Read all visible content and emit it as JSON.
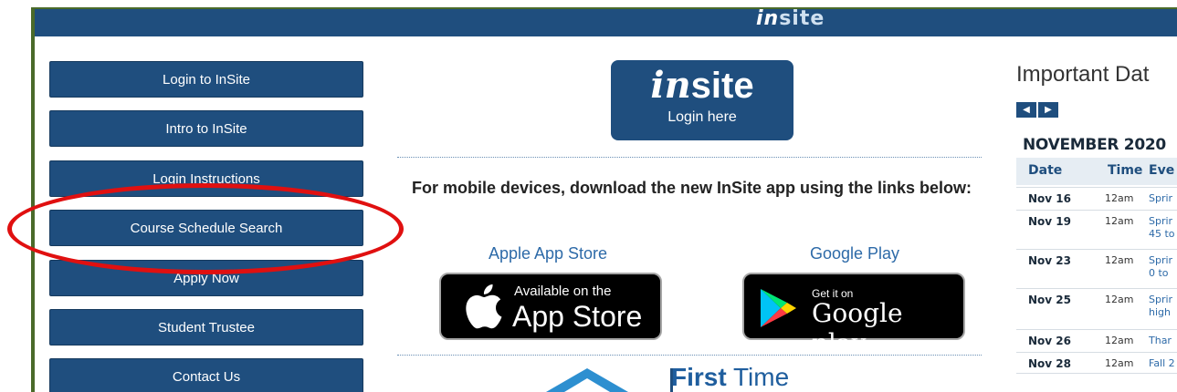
{
  "header": {
    "logo_in": "in",
    "logo_site": "site"
  },
  "nav": [
    "Login to InSite",
    "Intro to InSite",
    "Login Instructions",
    "Course Schedule Search",
    "Apply Now",
    "Student Trustee",
    "Contact Us"
  ],
  "insite": {
    "logo_in": "in",
    "logo_site": "site",
    "sub": "Login here"
  },
  "mobile": {
    "text": "For mobile devices, download the new InSite app using the links below:",
    "apple_title": "Apple App Store",
    "google_title": "Google Play",
    "apple_small": "Available on the",
    "apple_big": "App Store",
    "google_small": "Get it on",
    "google_big": "Google play"
  },
  "first_time": {
    "bold": "First",
    "rest": " Time"
  },
  "important": {
    "title": "Important Dat",
    "prev_icon": "triangle-left-icon",
    "next_icon": "triangle-right-icon",
    "month": "NOVEMBER 2020",
    "headers": [
      "Date",
      "Time",
      "Eve"
    ],
    "rows": [
      {
        "date": "Nov 16",
        "time": "12am",
        "event": [
          "Sprir"
        ]
      },
      {
        "date": "Nov 19",
        "time": "12am",
        "event": [
          "Sprir",
          "45 to"
        ]
      },
      {
        "date": "Nov 23",
        "time": "12am",
        "event": [
          "Sprir",
          "0 to"
        ]
      },
      {
        "date": "Nov 25",
        "time": "12am",
        "event": [
          "Sprir",
          "high"
        ]
      },
      {
        "date": "Nov 26",
        "time": "12am",
        "event": [
          "Thar"
        ]
      },
      {
        "date": "Nov 28",
        "time": "12am",
        "event": [
          "Fall 2"
        ]
      }
    ]
  },
  "colors": {
    "brand_blue": "#1f4e7e",
    "highlight_red": "#e01010",
    "link_blue": "#2d6aa8"
  }
}
